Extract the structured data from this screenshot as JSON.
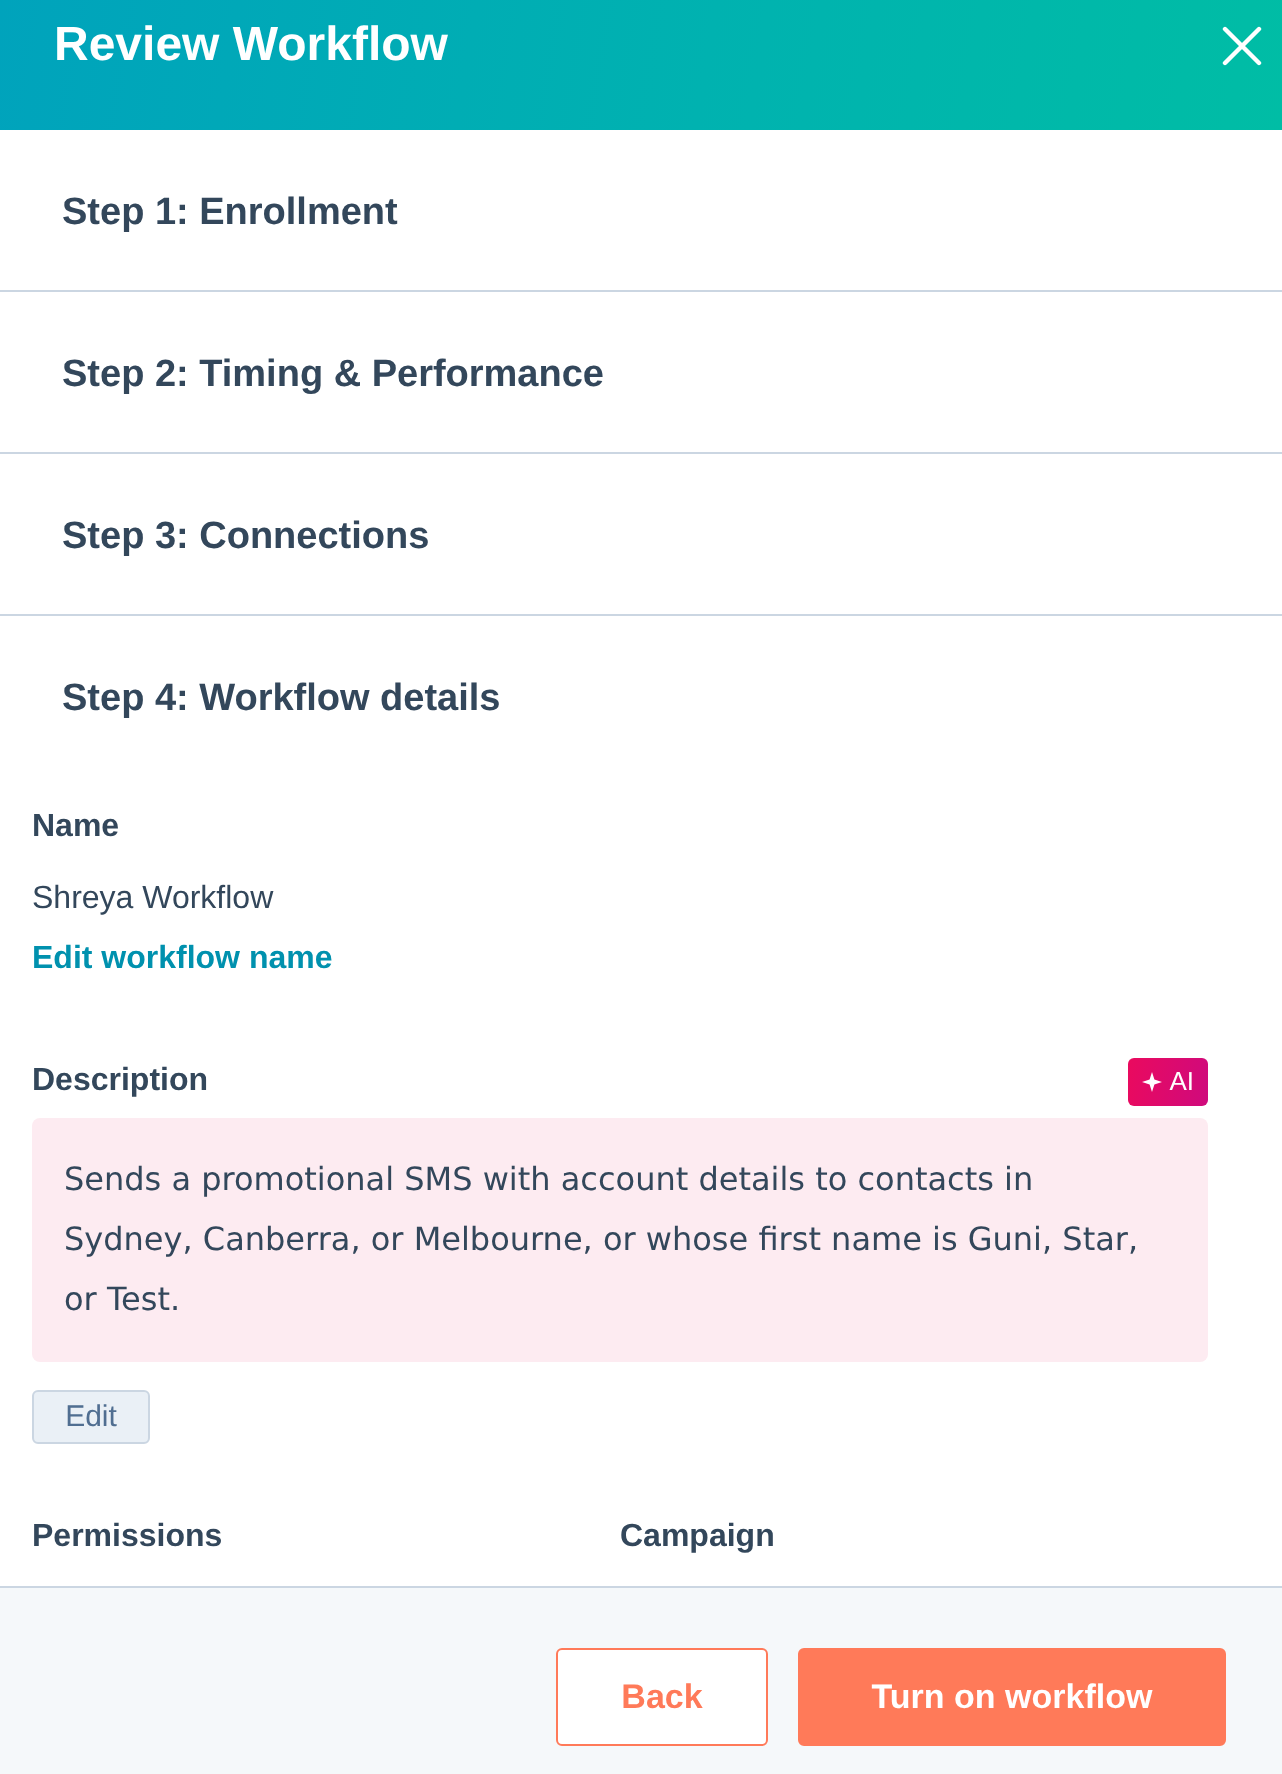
{
  "header": {
    "title": "Review Workflow"
  },
  "steps": [
    {
      "title": "Step 1: Enrollment",
      "expanded": false
    },
    {
      "title": "Step 2: Timing & Performance",
      "expanded": false
    },
    {
      "title": "Step 3: Connections",
      "expanded": false
    },
    {
      "title": "Step 4: Workflow details",
      "expanded": true,
      "details": {
        "name_label": "Name",
        "name_value": "Shreya Workflow",
        "edit_name_link": "Edit workflow name",
        "description_label": "Description",
        "ai_button": "AI",
        "description": "Sends a promotional SMS with account details to contacts in Sydney, Canberra, or Melbourne, or whose first name is Guni, Star, or Test.",
        "edit_button": "Edit",
        "permissions_label": "Permissions",
        "campaign_label": "Campaign"
      }
    }
  ],
  "footer": {
    "buttons": [
      {
        "label": "Back",
        "kind": "secondary"
      },
      {
        "label": "Turn on workflow",
        "kind": "primary"
      }
    ]
  }
}
